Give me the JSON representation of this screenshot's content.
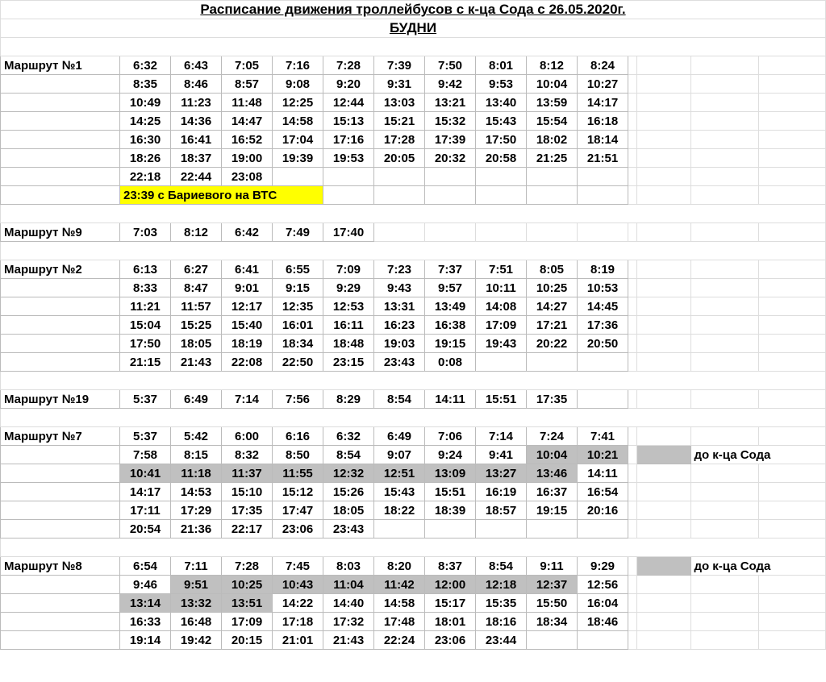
{
  "title": "Расписание движения троллейбусов с к-ца Сода с 26.05.2020г.",
  "subtitle": "БУДНИ",
  "legend_note": "до к-ца Сода",
  "routes": {
    "r1": {
      "name": "Маршрут №1",
      "rows": [
        [
          "6:32",
          "6:43",
          "7:05",
          "7:16",
          "7:28",
          "7:39",
          "7:50",
          "8:01",
          "8:12",
          "8:24"
        ],
        [
          "8:35",
          "8:46",
          "8:57",
          "9:08",
          "9:20",
          "9:31",
          "9:42",
          "9:53",
          "10:04",
          "10:27"
        ],
        [
          "10:49",
          "11:23",
          "11:48",
          "12:25",
          "12:44",
          "13:03",
          "13:21",
          "13:40",
          "13:59",
          "14:17"
        ],
        [
          "14:25",
          "14:36",
          "14:47",
          "14:58",
          "15:13",
          "15:21",
          "15:32",
          "15:43",
          "15:54",
          "16:18"
        ],
        [
          "16:30",
          "16:41",
          "16:52",
          "17:04",
          "17:16",
          "17:28",
          "17:39",
          "17:50",
          "18:02",
          "18:14"
        ],
        [
          "18:26",
          "18:37",
          "19:00",
          "19:39",
          "19:53",
          "20:05",
          "20:32",
          "20:58",
          "21:25",
          "21:51"
        ],
        [
          "22:18",
          "22:44",
          "23:08",
          "",
          "",
          "",
          "",
          "",
          "",
          ""
        ]
      ],
      "special": "23:39 с Бариевого на ВТС"
    },
    "r9": {
      "name": "Маршрут №9",
      "rows": [
        [
          "7:03",
          "8:12",
          "6:42",
          "7:49",
          "17:40"
        ]
      ]
    },
    "r2": {
      "name": "Маршрут №2",
      "rows": [
        [
          "6:13",
          "6:27",
          "6:41",
          "6:55",
          "7:09",
          "7:23",
          "7:37",
          "7:51",
          "8:05",
          "8:19"
        ],
        [
          "8:33",
          "8:47",
          "9:01",
          "9:15",
          "9:29",
          "9:43",
          "9:57",
          "10:11",
          "10:25",
          "10:53"
        ],
        [
          "11:21",
          "11:57",
          "12:17",
          "12:35",
          "12:53",
          "13:31",
          "13:49",
          "14:08",
          "14:27",
          "14:45"
        ],
        [
          "15:04",
          "15:25",
          "15:40",
          "16:01",
          "16:11",
          "16:23",
          "16:38",
          "17:09",
          "17:21",
          "17:36"
        ],
        [
          "17:50",
          "18:05",
          "18:19",
          "18:34",
          "18:48",
          "19:03",
          "19:15",
          "19:43",
          "20:22",
          "20:50"
        ],
        [
          "21:15",
          "21:43",
          "22:08",
          "22:50",
          "23:15",
          "23:43",
          "0:08",
          "",
          "",
          ""
        ]
      ]
    },
    "r19": {
      "name": "Маршрут №19",
      "rows": [
        [
          "5:37",
          "6:49",
          "7:14",
          "7:56",
          "8:29",
          "8:54",
          "14:11",
          "15:51",
          "17:35",
          ""
        ]
      ]
    },
    "r7": {
      "name": "Маршрут №7",
      "rows": [
        {
          "cells": [
            "5:37",
            "5:42",
            "6:00",
            "6:16",
            "6:32",
            "6:49",
            "7:06",
            "7:14",
            "7:24",
            "7:41"
          ],
          "grey": []
        },
        {
          "cells": [
            "7:58",
            "8:15",
            "8:32",
            "8:50",
            "8:54",
            "9:07",
            "9:24",
            "9:41",
            "10:04",
            "10:21"
          ],
          "grey": [
            8,
            9
          ]
        },
        {
          "cells": [
            "10:41",
            "11:18",
            "11:37",
            "11:55",
            "12:32",
            "12:51",
            "13:09",
            "13:27",
            "13:46",
            "14:11"
          ],
          "grey": [
            0,
            1,
            2,
            3,
            4,
            5,
            6,
            7,
            8
          ]
        },
        {
          "cells": [
            "14:17",
            "14:53",
            "15:10",
            "15:12",
            "15:26",
            "15:43",
            "15:51",
            "16:19",
            "16:37",
            "16:54"
          ],
          "grey": []
        },
        {
          "cells": [
            "17:11",
            "17:29",
            "17:35",
            "17:47",
            "18:05",
            "18:22",
            "18:39",
            "18:57",
            "19:15",
            "20:16"
          ],
          "grey": []
        },
        {
          "cells": [
            "20:54",
            "21:36",
            "22:17",
            "23:06",
            "23:43",
            "",
            "",
            "",
            "",
            ""
          ],
          "grey": []
        }
      ]
    },
    "r8": {
      "name": "Маршрут №8",
      "rows": [
        {
          "cells": [
            "6:54",
            "7:11",
            "7:28",
            "7:45",
            "8:03",
            "8:20",
            "8:37",
            "8:54",
            "9:11",
            "9:29"
          ],
          "grey": []
        },
        {
          "cells": [
            "9:46",
            "9:51",
            "10:25",
            "10:43",
            "11:04",
            "11:42",
            "12:00",
            "12:18",
            "12:37",
            "12:56"
          ],
          "grey": [
            1,
            2,
            3,
            4,
            5,
            6,
            7,
            8
          ]
        },
        {
          "cells": [
            "13:14",
            "13:32",
            "13:51",
            "14:22",
            "14:40",
            "14:58",
            "15:17",
            "15:35",
            "15:50",
            "16:04"
          ],
          "grey": [
            0,
            1,
            2
          ]
        },
        {
          "cells": [
            "16:33",
            "16:48",
            "17:09",
            "17:18",
            "17:32",
            "17:48",
            "18:01",
            "18:16",
            "18:34",
            "18:46"
          ],
          "grey": []
        },
        {
          "cells": [
            "19:14",
            "19:42",
            "20:15",
            "21:01",
            "21:43",
            "22:24",
            "23:06",
            "23:44",
            "",
            ""
          ],
          "grey": []
        }
      ]
    }
  }
}
